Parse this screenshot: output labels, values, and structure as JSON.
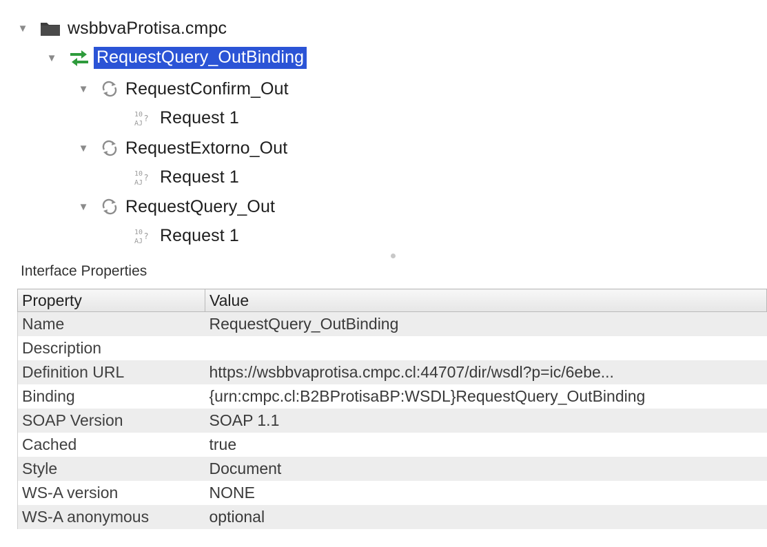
{
  "tree": {
    "project": {
      "label": "wsbbvaProtisa.cmpc"
    },
    "interface": {
      "label": "RequestQuery_OutBinding"
    },
    "operations": [
      {
        "label": "RequestConfirm_Out",
        "request": "Request 1"
      },
      {
        "label": "RequestExtorno_Out",
        "request": "Request 1"
      },
      {
        "label": "RequestQuery_Out",
        "request": "Request 1"
      }
    ]
  },
  "properties_panel": {
    "title": "Interface Properties",
    "headers": {
      "property": "Property",
      "value": "Value"
    },
    "rows": [
      {
        "property": "Name",
        "value": "RequestQuery_OutBinding"
      },
      {
        "property": "Description",
        "value": ""
      },
      {
        "property": "Definition URL",
        "value": "https://wsbbvaprotisa.cmpc.cl:44707/dir/wsdl?p=ic/6ebe..."
      },
      {
        "property": "Binding",
        "value": "{urn:cmpc.cl:B2BProtisaBP:WSDL}RequestQuery_OutBinding"
      },
      {
        "property": "SOAP Version",
        "value": "SOAP 1.1"
      },
      {
        "property": "Cached",
        "value": "true"
      },
      {
        "property": "Style",
        "value": "Document"
      },
      {
        "property": "WS-A version",
        "value": "NONE"
      },
      {
        "property": "WS-A anonymous",
        "value": "optional"
      }
    ]
  },
  "colors": {
    "selection": "#2b54d6",
    "interface_icon": "#2e9b3c",
    "folder_icon": "#3d3d3d"
  },
  "icons": [
    "twisty-expanded-icon",
    "folder-icon",
    "binding-interface-icon",
    "operation-cycle-icon",
    "soap-request-icon"
  ]
}
